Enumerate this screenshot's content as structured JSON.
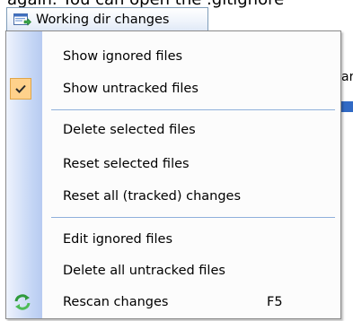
{
  "background": {
    "top_text": "again. You can open the .gitignore",
    "side_text": "ar"
  },
  "tab": {
    "label": "Working dir changes",
    "icon": "window-changes-icon"
  },
  "menu": {
    "items": [
      {
        "label": "Show ignored files",
        "checked": false
      },
      {
        "label": "Show untracked files",
        "checked": true
      },
      {
        "label": "Delete selected files"
      },
      {
        "label": "Reset selected files"
      },
      {
        "label": "Reset all (tracked) changes"
      },
      {
        "label": "Edit ignored files"
      },
      {
        "label": "Delete all untracked files"
      },
      {
        "label": "Rescan changes",
        "shortcut": "F5",
        "icon": "refresh-icon"
      }
    ]
  },
  "colors": {
    "check_bg": "#ffd18b",
    "check_border": "#e0a548",
    "separator": "#8fb0db",
    "gutter": "#c5d6f5"
  }
}
